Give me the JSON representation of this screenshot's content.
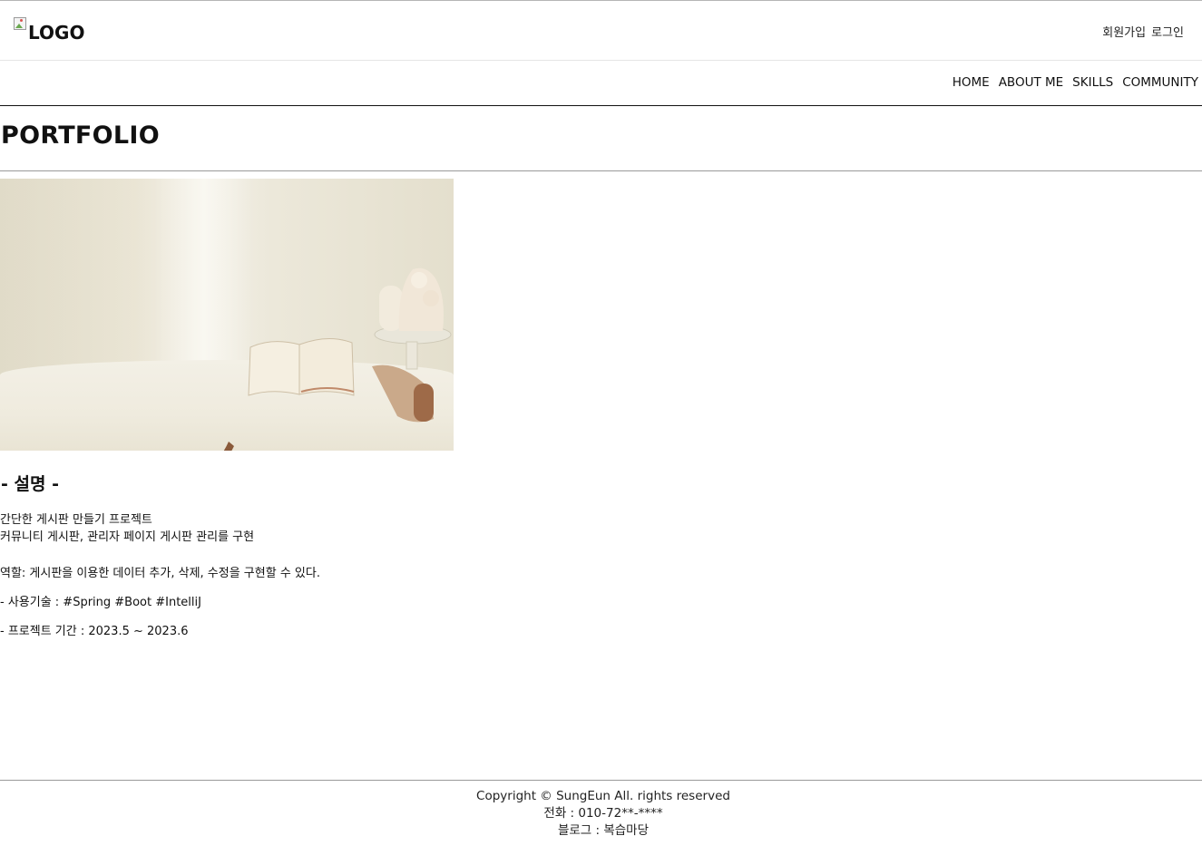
{
  "header": {
    "logo_text": "LOGO",
    "signup_label": "회원가입",
    "login_label": "로그인"
  },
  "nav": {
    "items": [
      "HOME",
      "ABOUT ME",
      "SKILLS",
      "COMMUNITY"
    ]
  },
  "main": {
    "page_title": "PORTFOLIO",
    "section_heading": "- 설명 -",
    "description_lines": [
      "간단한 게시판 만들기 프로젝트",
      "커뮤니티 게시판, 관리자 페이지 게시판 관리를 구현"
    ],
    "role": "역할: 게시판을 이용한 데이터 추가, 삭제, 수정을 구현할 수 있다.",
    "skills": "- 사용기술 : #Spring #Boot #IntelliJ",
    "period": "- 프로젝트 기간 : 2023.5 ~ 2023.6"
  },
  "footer": {
    "copyright": "Copyright © SungEun All. rights reserved",
    "phone": "전화 : 010-72**-****",
    "blog": "블로그 : 복습마당"
  }
}
